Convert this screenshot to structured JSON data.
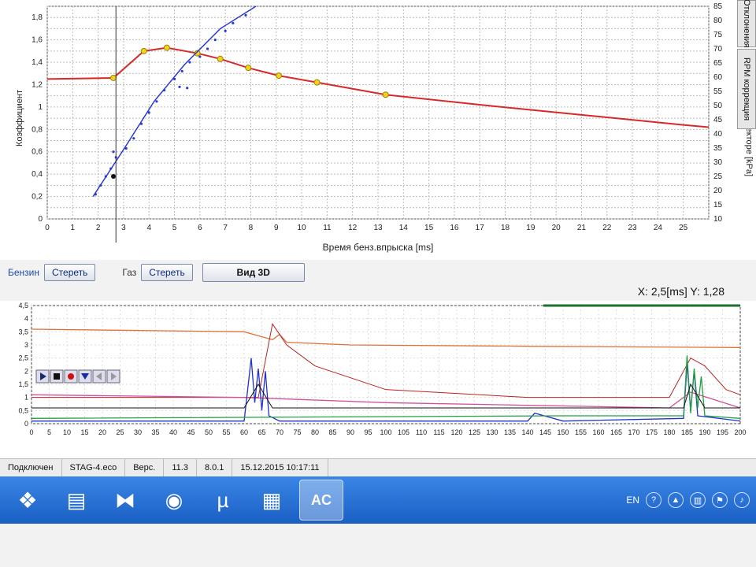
{
  "top_chart": {
    "ylabel_left": "Коэффициент",
    "ylabel_right": "Давление в коллекторе [kPa]",
    "xlabel": "Время бенз.впрыска [ms]",
    "x_ticks": [
      "0",
      "1",
      "2",
      "3",
      "4",
      "5",
      "6",
      "7",
      "8",
      "9",
      "10",
      "11",
      "12",
      "13",
      "14",
      "15",
      "16",
      "17",
      "18",
      "19",
      "20",
      "21",
      "22",
      "23",
      "24",
      "25"
    ],
    "y_left_ticks": [
      "0",
      "0,2",
      "0,4",
      "0,6",
      "0,8",
      "1",
      "1,2",
      "1,4",
      "1,6",
      "1,8"
    ],
    "y_right_ticks": [
      "10",
      "15",
      "20",
      "25",
      "30",
      "35",
      "40",
      "45",
      "50",
      "55",
      "60",
      "65",
      "70",
      "75",
      "80",
      "85"
    ]
  },
  "side_tabs": [
    "Отклонения",
    "RPM коррекция"
  ],
  "toolbar": {
    "benzin_label": "Бензин",
    "erase1": "Стереть",
    "gas_label": "Газ",
    "erase2": "Стереть",
    "view3d": "Вид 3D"
  },
  "coords": {
    "x_label": "X:",
    "x_value": "2,5[ms]",
    "y_label": "Y:",
    "y_value": "1,28"
  },
  "bottom_chart": {
    "y_ticks": [
      "0",
      "0,5",
      "1",
      "1,5",
      "2",
      "2,5",
      "3",
      "3,5",
      "4",
      "4,5"
    ],
    "x_ticks": [
      "0",
      "5",
      "10",
      "15",
      "20",
      "25",
      "30",
      "35",
      "40",
      "45",
      "50",
      "55",
      "60",
      "65",
      "70",
      "75",
      "80",
      "85",
      "90",
      "95",
      "100",
      "105",
      "110",
      "115",
      "120",
      "125",
      "130",
      "135",
      "140",
      "145",
      "150",
      "155",
      "160",
      "165",
      "170",
      "175",
      "180",
      "185",
      "190",
      "195",
      "200"
    ]
  },
  "statusbar": {
    "status": "Подключен",
    "device": "STAG-4.eco",
    "version_label": "Верс.",
    "version": "11.3",
    "fw": "8.0.1",
    "datetime": "15.12.2015 10:17:11"
  },
  "tray": {
    "lang": "EN"
  },
  "colors": {
    "red_curve": "#d62a2a",
    "blue_points": "#2a3ad6",
    "yellow_marker": "#f2d21a",
    "taskbar": "#1f6fd6"
  }
}
